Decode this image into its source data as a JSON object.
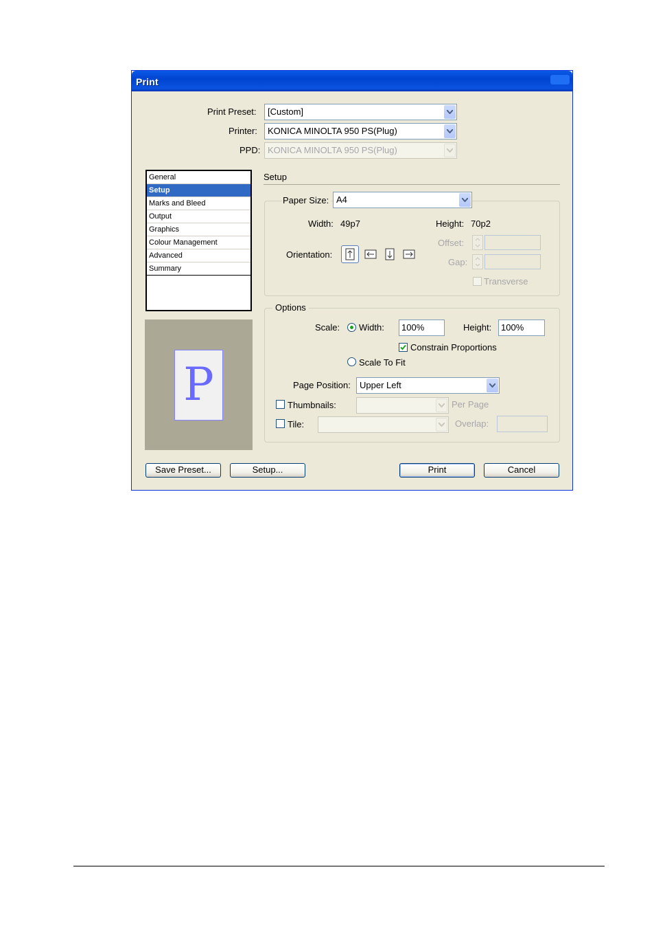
{
  "dialog": {
    "title": "Print",
    "print_preset_label": "Print Preset:",
    "print_preset_value": "[Custom]",
    "printer_label": "Printer:",
    "printer_value": "KONICA MINOLTA 950 PS(Plug)",
    "ppd_label": "PPD:",
    "ppd_value": "KONICA MINOLTA 950 PS(Plug)"
  },
  "sidebar": {
    "items": [
      {
        "label": "General",
        "selected": false
      },
      {
        "label": "Setup",
        "selected": true
      },
      {
        "label": "Marks and Bleed",
        "selected": false
      },
      {
        "label": "Output",
        "selected": false
      },
      {
        "label": "Graphics",
        "selected": false
      },
      {
        "label": "Colour Management",
        "selected": false
      },
      {
        "label": "Advanced",
        "selected": false
      },
      {
        "label": "Summary",
        "selected": false
      }
    ],
    "preview_letter": "P"
  },
  "setup": {
    "section_title": "Setup",
    "paper_size_label": "Paper Size:",
    "paper_size_value": "A4",
    "width_label": "Width:",
    "width_value": "49p7",
    "height_label": "Height:",
    "height_value": "70p2",
    "orientation_label": "Orientation:",
    "offset_label": "Offset:",
    "gap_label": "Gap:",
    "transverse_label": "Transverse"
  },
  "options": {
    "group_title": "Options",
    "scale_label": "Scale:",
    "width_radio_label": "Width:",
    "width_value": "100%",
    "height_label": "Height:",
    "height_value": "100%",
    "constrain_label": "Constrain Proportions",
    "constrain_checked": true,
    "scale_to_fit_label": "Scale To Fit",
    "page_position_label": "Page Position:",
    "page_position_value": "Upper Left",
    "thumbnails_label": "Thumbnails:",
    "per_page_label": "Per Page",
    "tile_label": "Tile:",
    "overlap_label": "Overlap:"
  },
  "buttons": {
    "save_preset": "Save Preset...",
    "setup": "Setup...",
    "print": "Print",
    "cancel": "Cancel"
  },
  "colors": {
    "titlebar": "#0a5ae8",
    "dialog_bg": "#ece9d8",
    "selection": "#316ac5",
    "preview_bg": "#aba895",
    "preview_letter": "#6a6aff"
  }
}
